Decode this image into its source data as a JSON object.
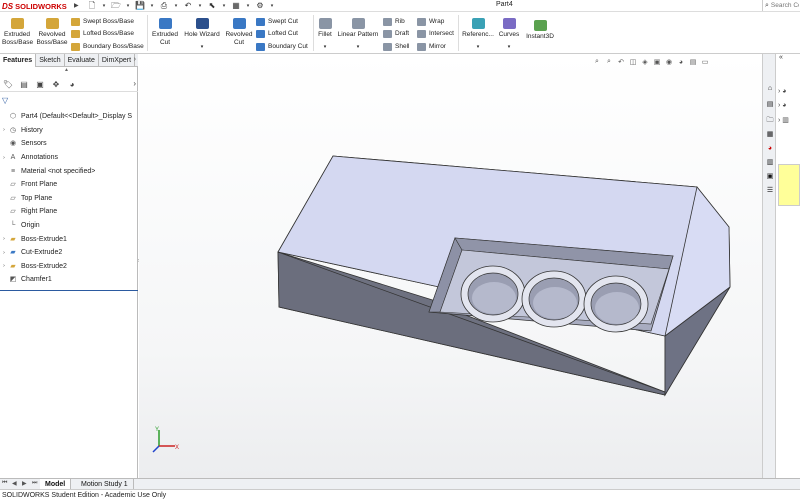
{
  "app": {
    "logo_ds": "DS",
    "logo_name": "SOLIDWORKS",
    "doc_title": "Part4"
  },
  "search": {
    "placeholder": "Search Co"
  },
  "ribbon": {
    "extruded_boss": "Extruded\nBoss/Base",
    "revolved_boss": "Revolved\nBoss/Base",
    "swept_boss": "Swept Boss/Base",
    "lofted_boss": "Lofted Boss/Base",
    "boundary_boss": "Boundary Boss/Base",
    "extruded_cut": "Extruded\nCut",
    "hole_wizard": "Hole Wizard",
    "revolved_cut": "Revolved\nCut",
    "swept_cut": "Swept Cut",
    "lofted_cut": "Lofted Cut",
    "boundary_cut": "Boundary Cut",
    "fillet": "Fillet",
    "linear_pattern": "Linear Pattern",
    "rib": "Rib",
    "draft": "Draft",
    "shell": "Shell",
    "wrap": "Wrap",
    "intersect": "Intersect",
    "mirror": "Mirror",
    "reference": "Referenc...",
    "curves": "Curves",
    "instant3d": "Instant3D"
  },
  "fm_tabs": [
    "Features",
    "Sketch",
    "Evaluate",
    "DimXpert"
  ],
  "tree": [
    {
      "label": "Part4  (Default<<Default>_Display S",
      "icon": "part-icon",
      "expand": ""
    },
    {
      "label": "History",
      "icon": "history-icon",
      "expand": "›"
    },
    {
      "label": "Sensors",
      "icon": "sensors-icon",
      "expand": ""
    },
    {
      "label": "Annotations",
      "icon": "annotations-icon",
      "expand": "›"
    },
    {
      "label": "Material <not specified>",
      "icon": "material-icon",
      "expand": ""
    },
    {
      "label": "Front Plane",
      "icon": "plane-icon",
      "expand": ""
    },
    {
      "label": "Top Plane",
      "icon": "plane-icon",
      "expand": ""
    },
    {
      "label": "Right Plane",
      "icon": "plane-icon",
      "expand": ""
    },
    {
      "label": "Origin",
      "icon": "origin-icon",
      "expand": ""
    },
    {
      "label": "Boss-Extrude1",
      "icon": "boss-extrude-icon",
      "expand": "›"
    },
    {
      "label": "Cut-Extrude2",
      "icon": "cut-extrude-icon",
      "expand": "›"
    },
    {
      "label": "Boss-Extrude2",
      "icon": "boss-extrude-icon",
      "expand": "›"
    },
    {
      "label": "Chamfer1",
      "icon": "chamfer-icon",
      "expand": ""
    }
  ],
  "bottom_tabs": [
    "Model",
    "Motion Study 1"
  ],
  "status": "SOLIDWORKS Student Edition - Academic Use Only",
  "triad": {
    "x": "X",
    "y": "Y"
  },
  "colors": {
    "accent": "#c00000",
    "model_face_top": "#d8dcf4",
    "model_face_side": "#6e7180",
    "note": "#ffff99"
  }
}
